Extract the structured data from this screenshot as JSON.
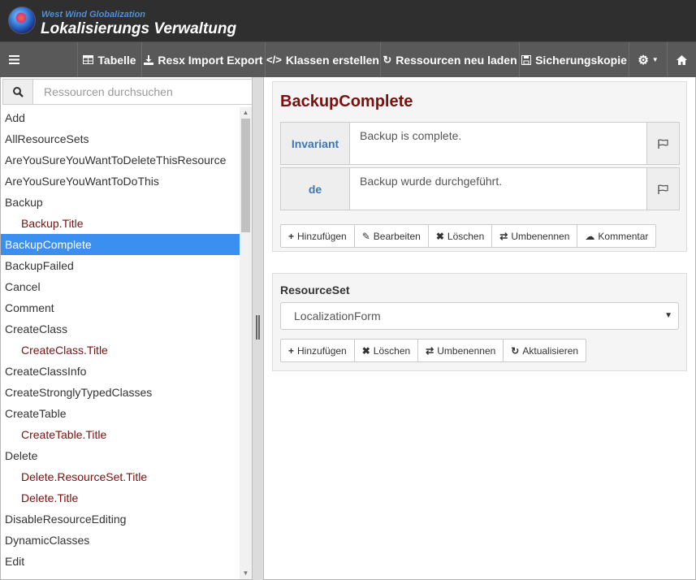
{
  "header": {
    "brand_small": "West Wind Globalization",
    "title": "Lokalisierungs Verwaltung"
  },
  "toolbar": {
    "menu_icon": "menu-icon",
    "buttons": [
      {
        "label": "Tabelle",
        "icon": "table-icon"
      },
      {
        "label": "Resx Import Export",
        "icon": "download-icon"
      },
      {
        "label": "Klassen erstellen",
        "icon": "code-icon"
      },
      {
        "label": "Ressourcen neu laden",
        "icon": "refresh-icon"
      },
      {
        "label": "Sicherungskopie",
        "icon": "save-icon"
      }
    ],
    "settings_icon": "gear-icon",
    "home_icon": "home-icon"
  },
  "sidebar": {
    "search_placeholder": "Ressourcen durchsuchen",
    "items": [
      {
        "label": "Add",
        "child": false,
        "selected": false
      },
      {
        "label": "AllResourceSets",
        "child": false,
        "selected": false
      },
      {
        "label": "AreYouSureYouWantToDeleteThisResource",
        "child": false,
        "selected": false
      },
      {
        "label": "AreYouSureYouWantToDoThis",
        "child": false,
        "selected": false
      },
      {
        "label": "Backup",
        "child": false,
        "selected": false
      },
      {
        "label": "Backup.Title",
        "child": true,
        "selected": false
      },
      {
        "label": "BackupComplete",
        "child": false,
        "selected": true
      },
      {
        "label": "BackupFailed",
        "child": false,
        "selected": false
      },
      {
        "label": "Cancel",
        "child": false,
        "selected": false
      },
      {
        "label": "Comment",
        "child": false,
        "selected": false
      },
      {
        "label": "CreateClass",
        "child": false,
        "selected": false
      },
      {
        "label": "CreateClass.Title",
        "child": true,
        "selected": false
      },
      {
        "label": "CreateClassInfo",
        "child": false,
        "selected": false
      },
      {
        "label": "CreateStronglyTypedClasses",
        "child": false,
        "selected": false
      },
      {
        "label": "CreateTable",
        "child": false,
        "selected": false
      },
      {
        "label": "CreateTable.Title",
        "child": true,
        "selected": false
      },
      {
        "label": "Delete",
        "child": false,
        "selected": false
      },
      {
        "label": "Delete.ResourceSet.Title",
        "child": true,
        "selected": false
      },
      {
        "label": "Delete.Title",
        "child": true,
        "selected": false
      },
      {
        "label": "DisableResourceEditing",
        "child": false,
        "selected": false
      },
      {
        "label": "DynamicClasses",
        "child": false,
        "selected": false
      },
      {
        "label": "Edit",
        "child": false,
        "selected": false
      }
    ]
  },
  "resource": {
    "title": "BackupComplete",
    "values": [
      {
        "lang": "Invariant",
        "text": "Backup is complete."
      },
      {
        "lang": "de",
        "text": "Backup wurde durchgeführt."
      }
    ],
    "actions": [
      {
        "label": "Hinzufügen",
        "icon": "plus-icon"
      },
      {
        "label": "Bearbeiten",
        "icon": "edit-icon"
      },
      {
        "label": "Löschen",
        "icon": "times-icon"
      },
      {
        "label": "Umbenennen",
        "icon": "exchange-icon"
      },
      {
        "label": "Kommentar",
        "icon": "comment-icon"
      }
    ]
  },
  "resourceset": {
    "label": "ResourceSet",
    "selected": "LocalizationForm",
    "actions": [
      {
        "label": "Hinzufügen",
        "icon": "plus-icon"
      },
      {
        "label": "Löschen",
        "icon": "times-icon"
      },
      {
        "label": "Umbenennen",
        "icon": "exchange-icon"
      },
      {
        "label": "Aktualisieren",
        "icon": "refresh-icon"
      }
    ]
  }
}
